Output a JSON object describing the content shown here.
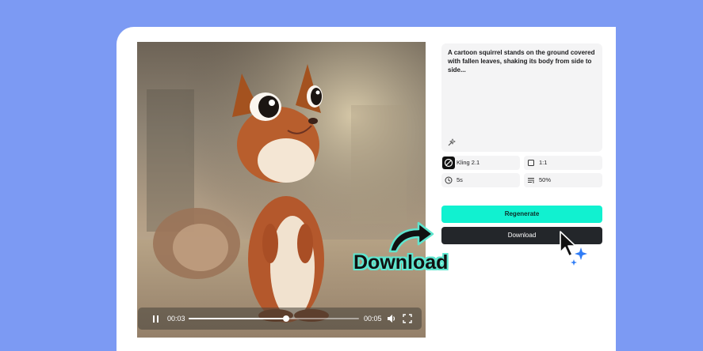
{
  "video": {
    "current_time": "00:03",
    "total_time": "00:05",
    "progress": 0.57,
    "icons": {
      "pause": "pause-icon",
      "volume": "volume-icon",
      "fullscreen": "fullscreen-icon"
    }
  },
  "prompt": {
    "text": "A cartoon squirrel stands on the ground covered with fallen leaves, shaking its body from side to side...",
    "tool_icon": "magic-wand-icon"
  },
  "settings": {
    "model": "Kling 2.1",
    "aspect_ratio": "1:1",
    "duration": "5s",
    "strength": "50%"
  },
  "buttons": {
    "regenerate": "Regenerate",
    "download": "Download"
  },
  "annotation": {
    "label": "Download"
  },
  "colors": {
    "background": "#7c9af3",
    "accent": "#11f1d0",
    "download_button": "#23262a",
    "callout_outline": "#5fe6cf",
    "sparkle": "#2f7cf6"
  }
}
